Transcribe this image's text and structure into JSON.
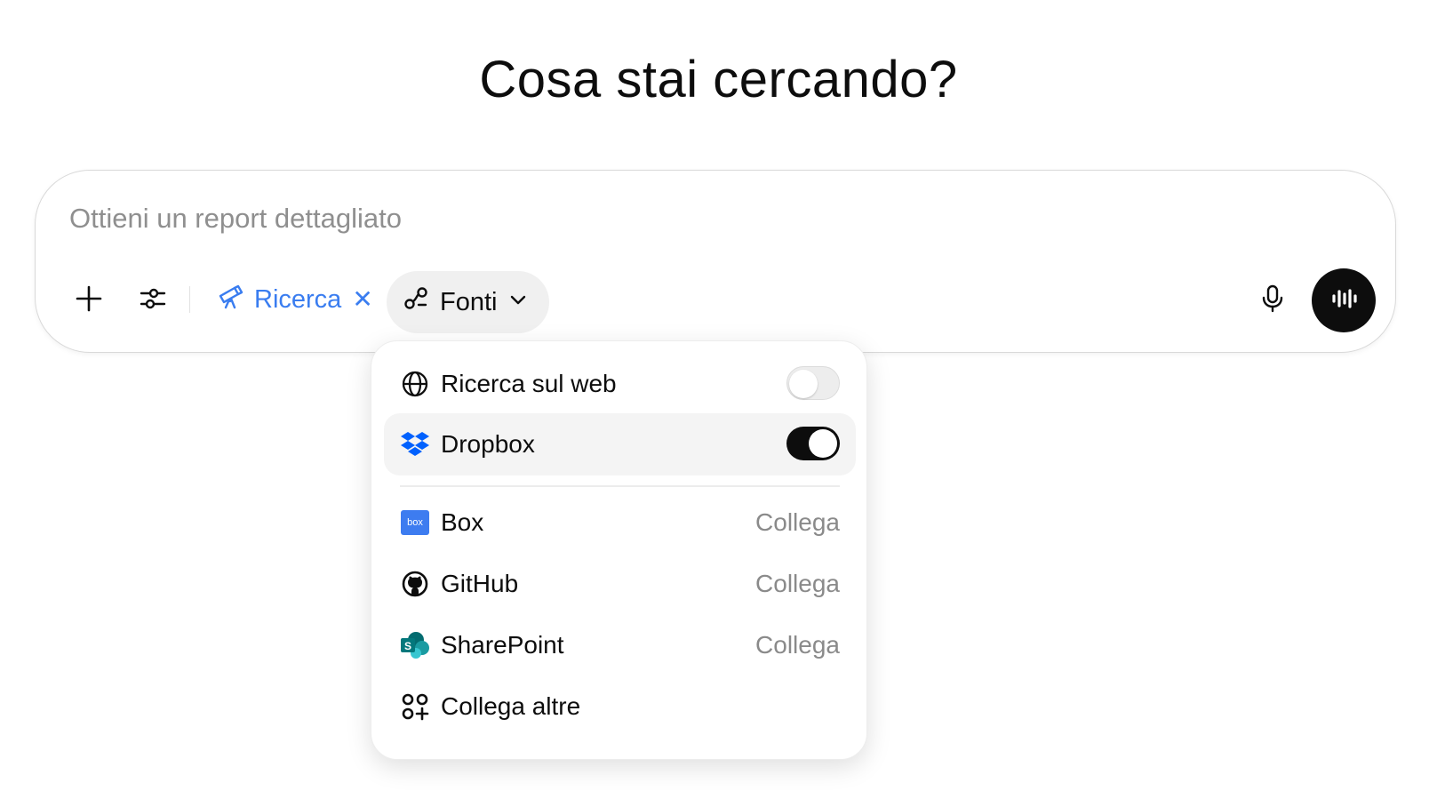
{
  "heading": "Cosa stai cercando?",
  "composer": {
    "placeholder": "Ottieni un report dettagliato",
    "value": ""
  },
  "toolbar": {
    "add_icon": "plus-icon",
    "tools_icon": "sliders-icon",
    "research_chip": {
      "label": "Ricerca",
      "icon": "telescope-icon",
      "remove_icon": "close-icon",
      "color": "#3a7df0"
    },
    "sources_chip": {
      "label": "Fonti",
      "icon": "sources-icon",
      "chevron": "chevron-down-icon"
    },
    "mic_icon": "microphone-icon",
    "voice_icon": "voice-waveform-icon"
  },
  "sources_menu": {
    "web": {
      "label": "Ricerca sul web",
      "icon": "globe-icon",
      "enabled": false
    },
    "dropbox": {
      "label": "Dropbox",
      "icon": "dropbox-icon",
      "enabled": true,
      "color": "#0061fe"
    },
    "connectors": [
      {
        "label": "Box",
        "icon": "box-icon",
        "action": "Collega"
      },
      {
        "label": "GitHub",
        "icon": "github-icon",
        "action": "Collega"
      },
      {
        "label": "SharePoint",
        "icon": "sharepoint-icon",
        "action": "Collega"
      }
    ],
    "more": {
      "label": "Collega altre",
      "icon": "apps-add-icon"
    }
  }
}
